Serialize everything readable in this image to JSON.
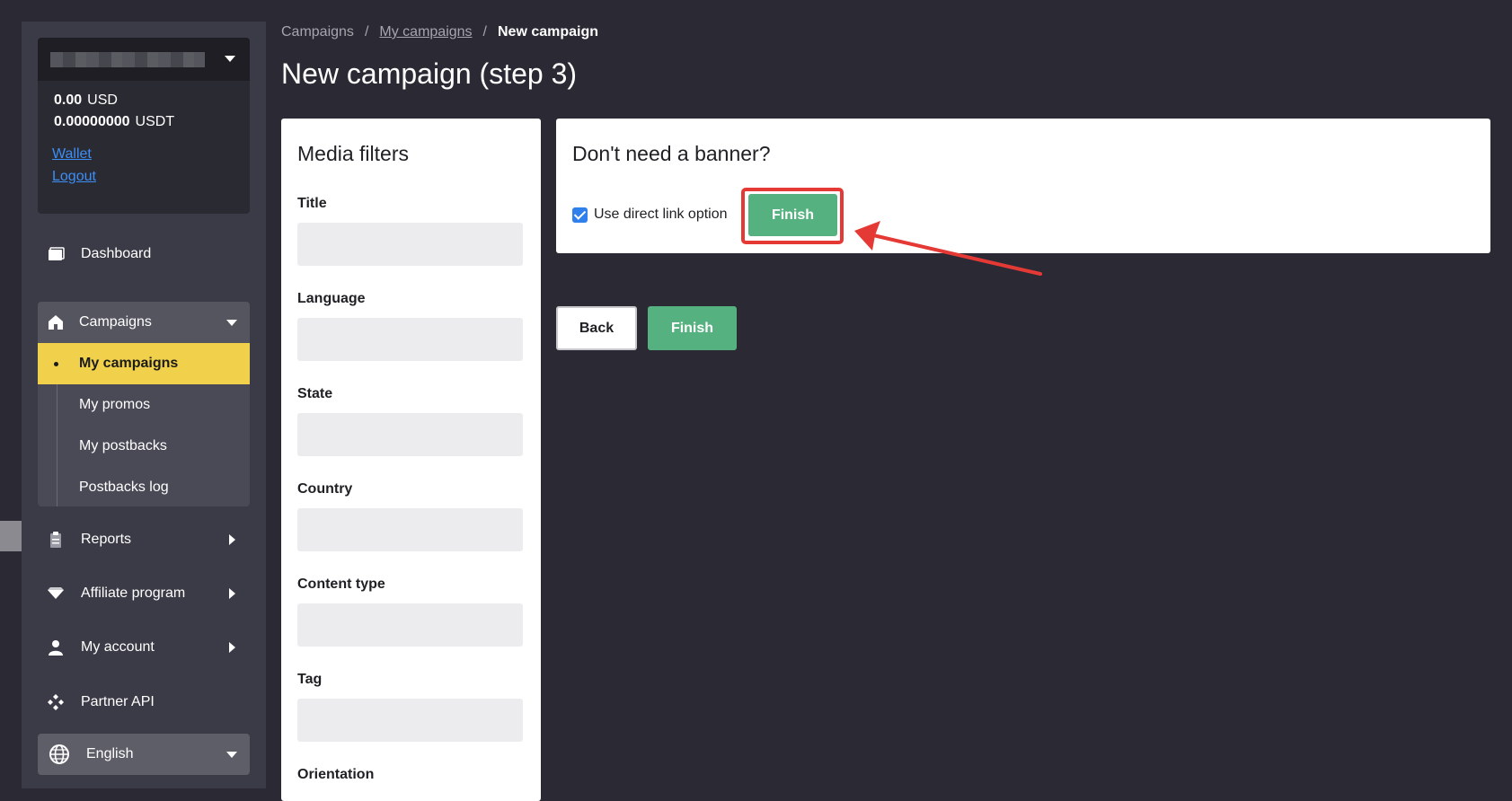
{
  "account": {
    "balance_usd_value": "0.00",
    "balance_usd_currency": "USD",
    "balance_usdt_value": "0.00000000",
    "balance_usdt_currency": "USDT",
    "wallet_link": "Wallet",
    "logout_link": "Logout"
  },
  "sidebar": {
    "dashboard": "Dashboard",
    "campaigns": "Campaigns",
    "campaign_items": [
      {
        "label": "My campaigns",
        "active": true
      },
      {
        "label": "My promos"
      },
      {
        "label": "My postbacks"
      },
      {
        "label": "Postbacks log"
      }
    ],
    "reports": "Reports",
    "affiliate": "Affiliate program",
    "my_account": "My account",
    "partner_api": "Partner API",
    "language": "English"
  },
  "breadcrumb": {
    "root": "Campaigns",
    "sep1": "/",
    "parent": "My campaigns",
    "sep2": "/",
    "current": "New campaign"
  },
  "page": {
    "title": "New campaign (step 3)"
  },
  "filters": {
    "title": "Media filters",
    "fields": [
      "Title",
      "Language",
      "State",
      "Country",
      "Content type",
      "Tag",
      "Orientation"
    ]
  },
  "banner": {
    "title": "Don't need a banner?",
    "checkbox_label": "Use direct link option",
    "checkbox_checked": true,
    "finish_label": "Finish"
  },
  "actions": {
    "back_label": "Back",
    "finish_label": "Finish"
  },
  "colors": {
    "accent_green": "#55b17f",
    "active_yellow": "#f1d04b",
    "link_blue": "#3d8ef5",
    "annotation_red": "#e53935"
  }
}
